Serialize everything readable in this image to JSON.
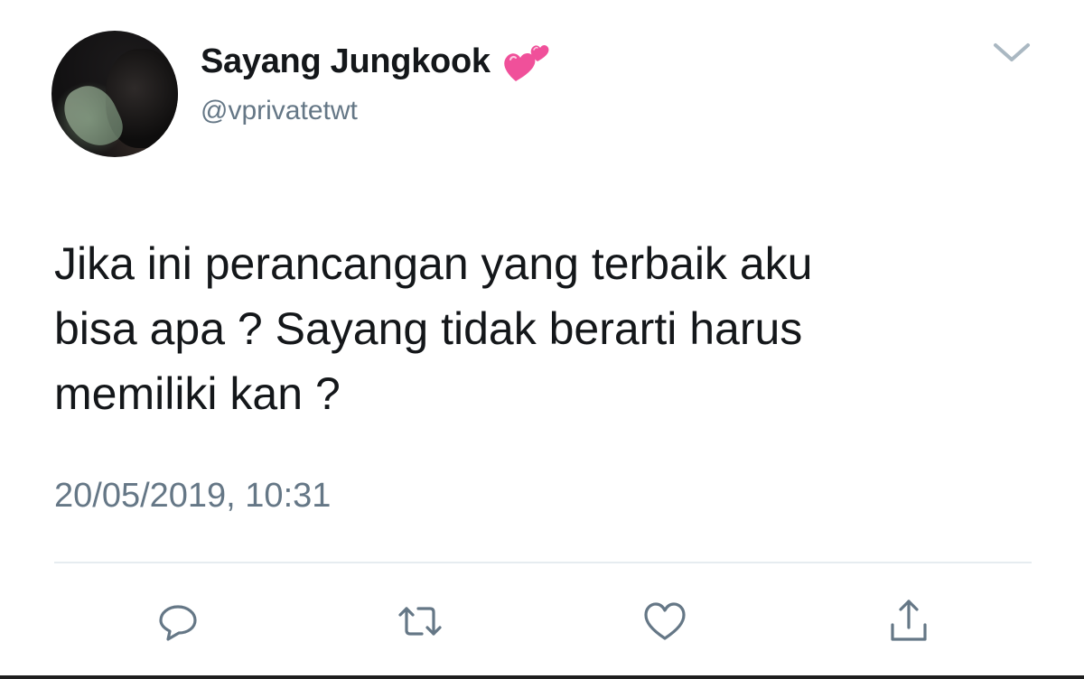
{
  "tweet": {
    "display_name": "Sayang Jungkook",
    "handle": "@vprivatetwt",
    "text": "Jika ini perancangan yang terbaik aku\nbisa apa ? Sayang tidak berarti harus\nmemiliki kan ?",
    "timestamp": "20/05/2019, 10:31"
  },
  "icons": {
    "name_emoji": "two-hearts-icon",
    "menu": "chevron-down-icon",
    "actions": [
      "reply-icon",
      "retweet-icon",
      "like-icon",
      "share-icon"
    ]
  },
  "colors": {
    "primary_text": "#14171a",
    "secondary_text": "#657786",
    "icon": "#657786",
    "divider": "#e6ecf0",
    "heart_emoji": "#f0509a"
  }
}
